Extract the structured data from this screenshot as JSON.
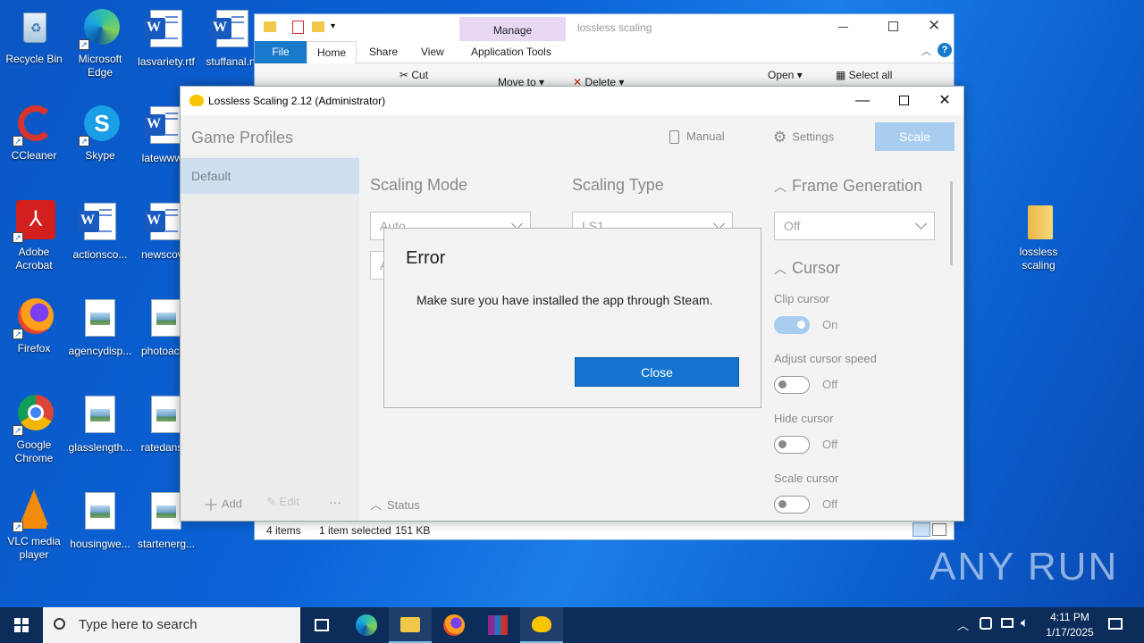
{
  "desktop": {
    "icons": [
      {
        "label": "Recycle Bin"
      },
      {
        "label": "Microsoft Edge"
      },
      {
        "label": "lasvariety.rtf"
      },
      {
        "label": "stuffanal.rtf"
      },
      {
        "label": "CCleaner"
      },
      {
        "label": "Skype"
      },
      {
        "label": "latewww..."
      },
      {
        "label": "Adobe Acrobat"
      },
      {
        "label": "actionsco..."
      },
      {
        "label": "newscov..."
      },
      {
        "label": "Firefox"
      },
      {
        "label": "agencydisp..."
      },
      {
        "label": "photoact..."
      },
      {
        "label": "Google Chrome"
      },
      {
        "label": "glasslength..."
      },
      {
        "label": "ratedans..."
      },
      {
        "label": "VLC media player"
      },
      {
        "label": "housingwe..."
      },
      {
        "label": "startenerg..."
      },
      {
        "label": "lossless scaling"
      }
    ]
  },
  "explorer": {
    "title": "lossless scaling",
    "manage_tab": "Manage",
    "tabs": [
      "File",
      "Home",
      "Share",
      "View",
      "Application Tools"
    ],
    "ribbon": {
      "cut": "Cut",
      "move_to": "Move to",
      "delete": "Delete",
      "open": "Open",
      "select_all": "Select all"
    },
    "status": {
      "items": "4 items",
      "selected": "1 item selected",
      "size": "151 KB"
    }
  },
  "lossless": {
    "title": "Lossless Scaling 2.12 (Administrator)",
    "header": "Game Profiles",
    "manual_label": "Manual",
    "settings_label": "Settings",
    "scale_label": "Scale",
    "profile_default": "Default",
    "add_label": "Add",
    "edit_label": "Edit",
    "more_label": "···",
    "status_label": "Status",
    "scaling_mode": {
      "title": "Scaling Mode",
      "value": "Auto",
      "second_value": "A"
    },
    "scaling_type": {
      "title": "Scaling Type",
      "value": "LS1"
    },
    "frame_generation": {
      "title": "Frame Generation",
      "value": "Off"
    },
    "cursor": {
      "title": "Cursor",
      "clip": {
        "label": "Clip cursor",
        "value": "On"
      },
      "adjust": {
        "label": "Adjust cursor speed",
        "value": "Off"
      },
      "hide": {
        "label": "Hide cursor",
        "value": "Off"
      },
      "scale": {
        "label": "Scale cursor",
        "value": "Off"
      }
    }
  },
  "dialog": {
    "title": "Error",
    "message": "Make sure you have installed the app through Steam.",
    "close_label": "Close"
  },
  "taskbar": {
    "search_placeholder": "Type here to search",
    "time": "4:11 PM",
    "date": "1/17/2025"
  },
  "watermark": "ANY RUN"
}
